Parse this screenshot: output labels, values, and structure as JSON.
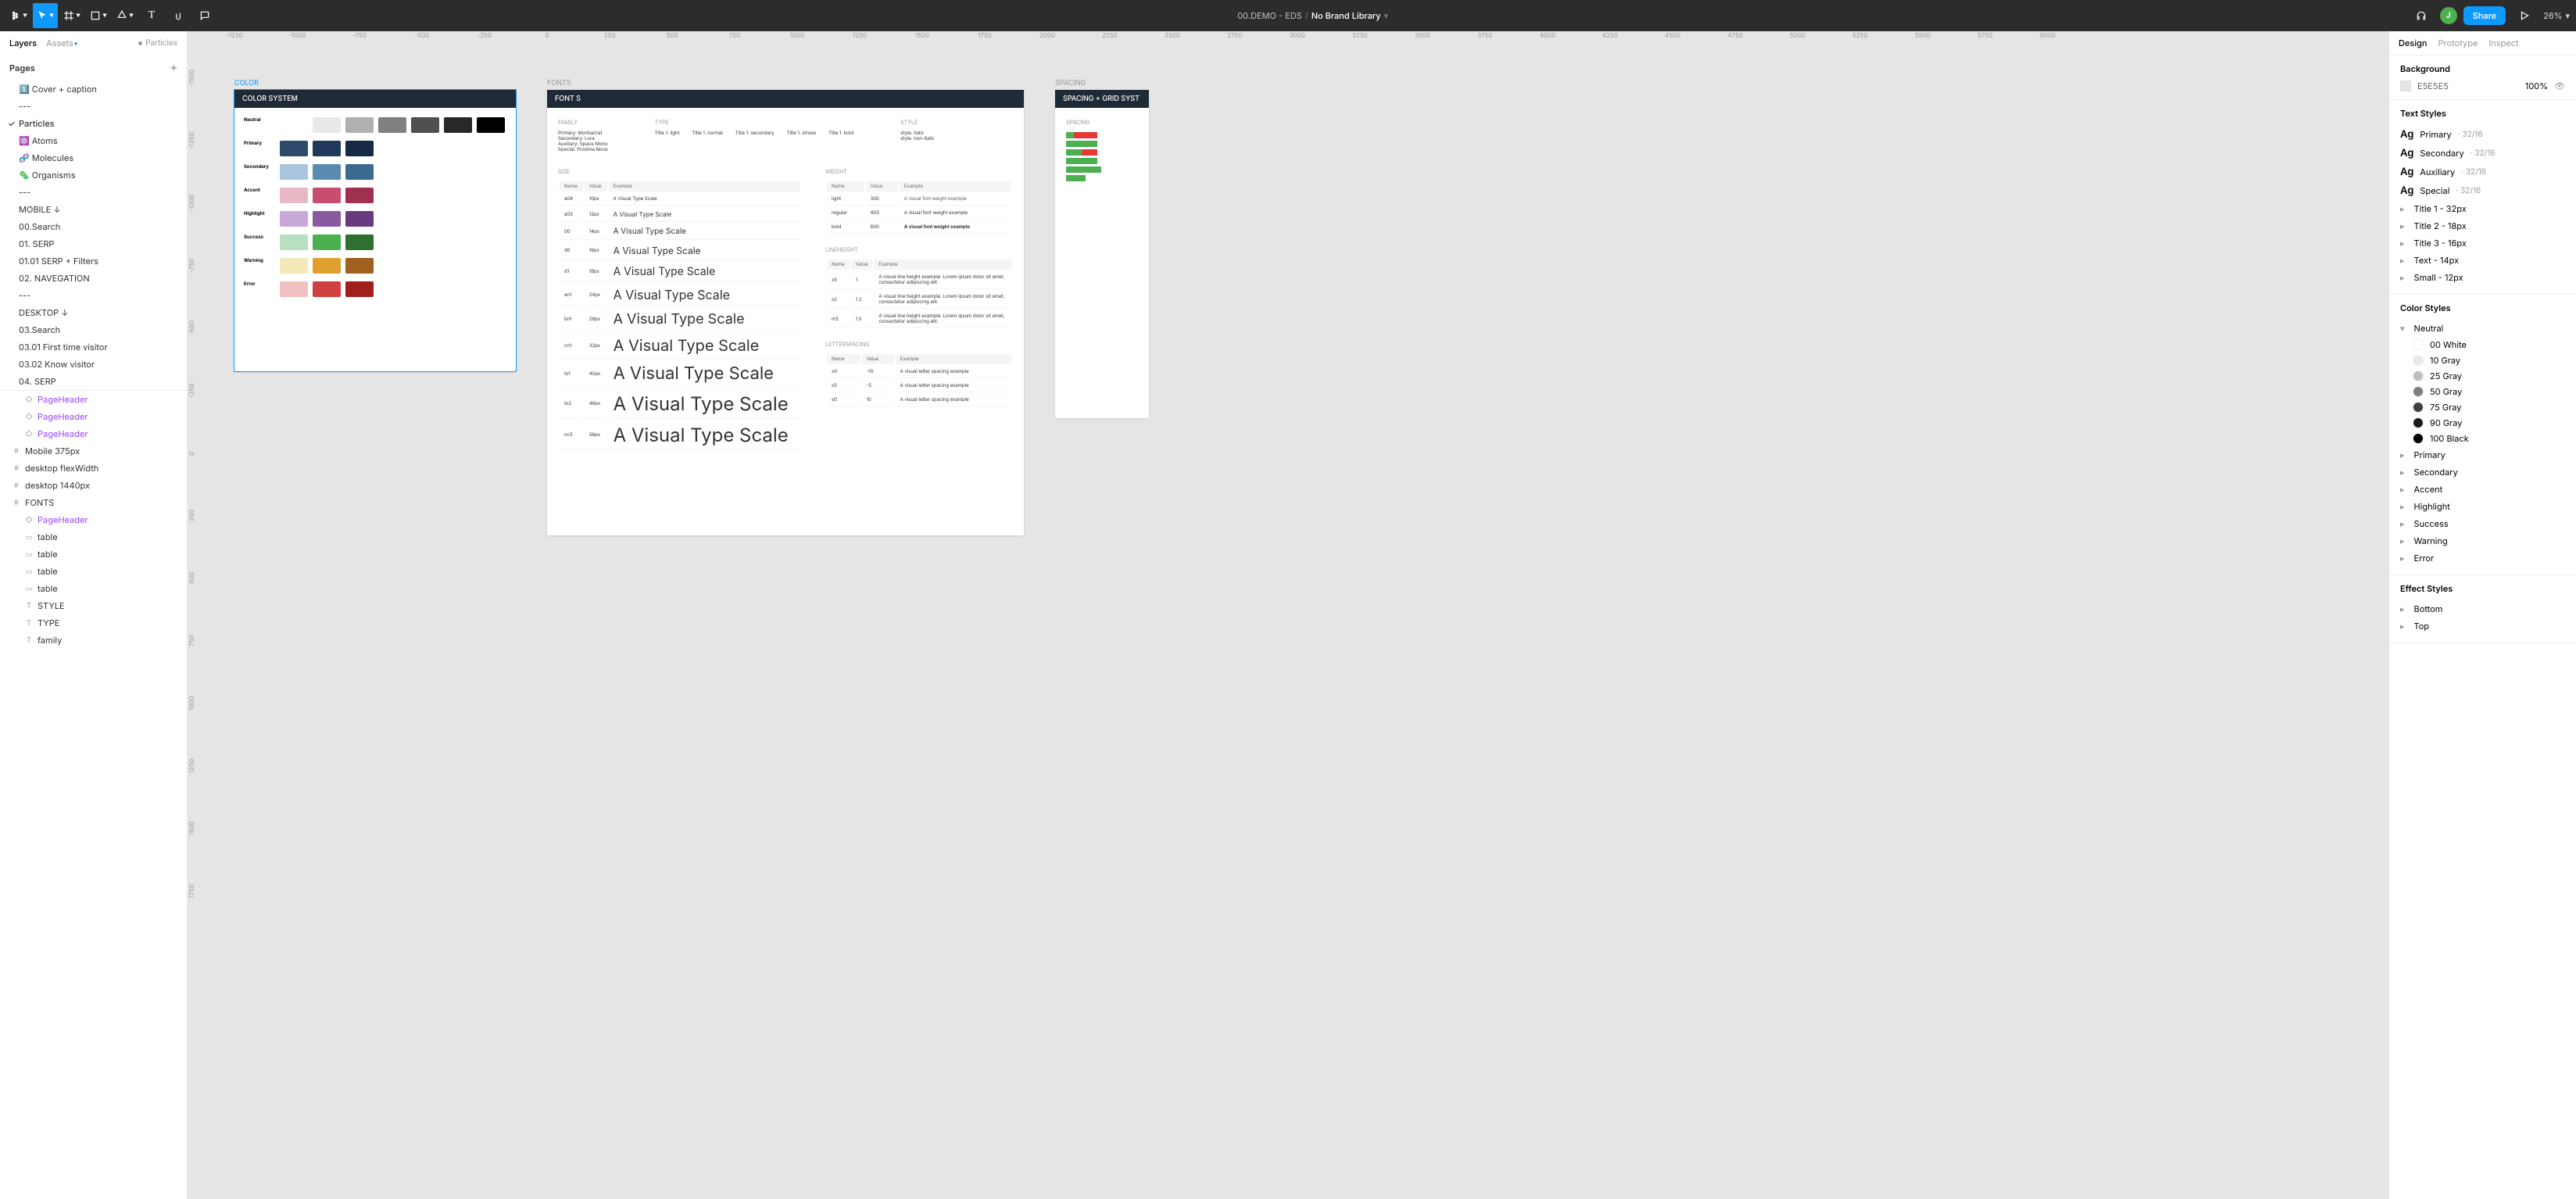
{
  "toolbar": {
    "file_path": "00.DEMO - EDS",
    "file_name": "No Brand Library",
    "share": "Share",
    "zoom": "26%",
    "avatar": "J"
  },
  "left": {
    "tabs": {
      "layers": "Layers",
      "assets": "Assets"
    },
    "location": "Particles",
    "pages_hdr": "Pages",
    "pages": [
      "1️⃣ Cover + caption",
      "---",
      "Particles",
      "⚛️ Atoms",
      "🧬 Molecules",
      "🦠 Organisms",
      "---",
      "MOBILE ↓",
      "00.Search",
      "01. SERP",
      "01.01 SERP + Filters",
      "02. NAVEGATION",
      "---",
      "DESKTOP ↓",
      "03.Search",
      "03.01 First time visitor",
      "03.02 Know visitor",
      "04. SERP"
    ],
    "selected_page": "Particles",
    "layers": [
      {
        "t": "PageHeader",
        "icon": "◇",
        "cls": "purple indent"
      },
      {
        "t": "PageHeader",
        "icon": "◇",
        "cls": "purple indent"
      },
      {
        "t": "PageHeader",
        "icon": "◇",
        "cls": "purple indent"
      },
      {
        "t": "Mobile 375px",
        "icon": "#"
      },
      {
        "t": "desktop flexWidth",
        "icon": "#"
      },
      {
        "t": "desktop 1440px",
        "icon": "#"
      },
      {
        "t": "FONTS",
        "icon": "#"
      },
      {
        "t": "PageHeader",
        "icon": "◇",
        "cls": "purple indent"
      },
      {
        "t": "table",
        "icon": "▭",
        "cls": "indent"
      },
      {
        "t": "table",
        "icon": "▭",
        "cls": "indent"
      },
      {
        "t": "table",
        "icon": "▭",
        "cls": "indent"
      },
      {
        "t": "table",
        "icon": "▭",
        "cls": "indent"
      },
      {
        "t": "STYLE",
        "icon": "T",
        "cls": "indent"
      },
      {
        "t": "TYPE",
        "icon": "T",
        "cls": "indent"
      },
      {
        "t": "family",
        "icon": "T",
        "cls": "indent"
      }
    ]
  },
  "ruler_h": [
    "-1250",
    "-1000",
    "-750",
    "-500",
    "-250",
    "0",
    "250",
    "500",
    "750",
    "1000",
    "1250",
    "1500",
    "1750",
    "2000",
    "2250",
    "2500",
    "2750",
    "3000",
    "3250",
    "3500",
    "3750",
    "4000",
    "4250",
    "4500",
    "4750",
    "5000",
    "5250",
    "5500",
    "5750",
    "6000"
  ],
  "ruler_v": [
    "-1500",
    "-1250",
    "-1000",
    "-750",
    "-500",
    "-250",
    "0",
    "250",
    "500",
    "750",
    "1000",
    "1250",
    "1500",
    "1750"
  ],
  "frames": {
    "color": {
      "label": "COLOR",
      "title": "COLOR SYSTEM",
      "rows": [
        {
          "name": "Neutral",
          "colors": [
            "#ffffff",
            "#e8e8e8",
            "#b0b0b0",
            "#808080",
            "#505050",
            "#282828",
            "#000000"
          ]
        },
        {
          "name": "Primary",
          "colors": [
            "#2e4a6b",
            "#1f3a5a",
            "#152b45"
          ]
        },
        {
          "name": "Secondary",
          "colors": [
            "#a8c5dd",
            "#5a8bb0",
            "#3a6a8f"
          ]
        },
        {
          "name": "Accent",
          "colors": [
            "#e8b8c5",
            "#c94d6f",
            "#a03050"
          ]
        },
        {
          "name": "Highlight",
          "colors": [
            "#c8a8d8",
            "#8a5aa0",
            "#6a3a80"
          ]
        },
        {
          "name": "Success",
          "colors": [
            "#b8e0c0",
            "#4caf50",
            "#2e7030"
          ]
        },
        {
          "name": "Warning",
          "colors": [
            "#f5e8b8",
            "#e0a030",
            "#a06020"
          ]
        },
        {
          "name": "Error",
          "colors": [
            "#f0c0c0",
            "#d04040",
            "#a02020"
          ]
        }
      ]
    },
    "fonts": {
      "label": "FONTS",
      "title": "FONT S",
      "family_hdr": "FAMILY",
      "type_hdr": "TYPE",
      "style_hdr": "STYLE",
      "families": [
        "Primary: Montserrat",
        "Secondary: Lora",
        "Auxiliary: Space Mono",
        "Special: Proxima Nova"
      ],
      "types": [
        "Title 1. light",
        "Title 1. normal",
        "Title 1. secondary",
        "Title 1. stroke",
        "Title 1. bold"
      ],
      "styles": [
        "style. italic",
        "style. non-italic"
      ],
      "size_hdr": "SIZE",
      "weight_hdr": "WEIGHT",
      "lineheight_hdr": "LINEHEIGHT",
      "letterspacing_hdr": "LETTERSPACING",
      "size_cols": [
        "Name",
        "Value",
        "Example"
      ],
      "sizes": [
        {
          "n": "a04",
          "v": "10px",
          "e": "A Visual Type Scale"
        },
        {
          "n": "a03",
          "v": "12px",
          "e": "A Visual Type Scale"
        },
        {
          "n": "00",
          "v": "14px",
          "e": "A Visual Type Scale"
        },
        {
          "n": "d0",
          "v": "16px",
          "e": "A Visual Type Scale"
        },
        {
          "n": "d1",
          "v": "18px",
          "e": "A Visual Type Scale"
        },
        {
          "n": "an1",
          "v": "24px",
          "e": "A Visual Type Scale"
        },
        {
          "n": "bn1",
          "v": "28px",
          "e": "A Visual Type Scale"
        },
        {
          "n": "cn1",
          "v": "32px",
          "e": "A Visual Type Scale"
        },
        {
          "n": "to1",
          "v": "40px",
          "e": "A Visual Type Scale"
        },
        {
          "n": "to2",
          "v": "48px",
          "e": "A Visual Type Scale"
        },
        {
          "n": "nc5",
          "v": "56px",
          "e": "A Visual Type Scale"
        }
      ],
      "weight_cols": [
        "Name",
        "Value",
        "Example"
      ],
      "weights": [
        {
          "n": "light",
          "v": "300",
          "e": "A visual font weight example"
        },
        {
          "n": "regular",
          "v": "400",
          "e": "A visual font weight example"
        },
        {
          "n": "bold",
          "v": "600",
          "e": "A visual font weight example"
        }
      ],
      "lh_cols": [
        "Name",
        "Value",
        "Example"
      ],
      "lhs": [
        {
          "n": "x5",
          "v": "1",
          "e": "A visual line height example. Lorem ipsum dolor sit amet, consectetur adipiscing elit."
        },
        {
          "n": "s2",
          "v": "1.2",
          "e": "A visual line height example. Lorem ipsum dolor sit amet, consectetur adipiscing elit."
        },
        {
          "n": "m5",
          "v": "1.5",
          "e": "A visual line height example. Lorem ipsum dolor sit amet, consectetur adipiscing elit."
        }
      ],
      "ls_cols": [
        "Name",
        "Value",
        "Example"
      ],
      "lss": [
        {
          "n": "x0",
          "v": "-10",
          "e": "A visual letter spacing example"
        },
        {
          "n": "s5",
          "v": "-5",
          "e": "A visual letter spacing example"
        },
        {
          "n": "s0",
          "v": "10",
          "e": "A visual letter spacing example"
        }
      ]
    },
    "spacing": {
      "label": "SPACING",
      "title": "SPACING + GRID SYST",
      "section": "SPACING"
    }
  },
  "right": {
    "tabs": {
      "design": "Design",
      "prototype": "Prototype",
      "inspect": "Inspect"
    },
    "bg_hdr": "Background",
    "bg_hex": "E5E5E5",
    "bg_pct": "100%",
    "ts_hdr": "Text Styles",
    "text_styles": [
      {
        "n": "Primary",
        "m": "32/16"
      },
      {
        "n": "Secondary",
        "m": "32/16"
      },
      {
        "n": "Auxiliary",
        "m": "32/16"
      },
      {
        "n": "Special",
        "m": "32/16"
      }
    ],
    "title_styles": [
      "Title 1 - 32px",
      "Title 2 - 18px",
      "Title 3 - 16px",
      "Text - 14px",
      "Small - 12px"
    ],
    "cs_hdr": "Color Styles",
    "neutral_hdr": "Neutral",
    "neutrals": [
      {
        "n": "00 White",
        "c": "#ffffff"
      },
      {
        "n": "10 Gray",
        "c": "#e8e8e8"
      },
      {
        "n": "25 Gray",
        "c": "#bfbfbf"
      },
      {
        "n": "50 Gray",
        "c": "#808080"
      },
      {
        "n": "75 Gray",
        "c": "#404040"
      },
      {
        "n": "90 Gray",
        "c": "#1a1a1a"
      },
      {
        "n": "100 Black",
        "c": "#000000"
      }
    ],
    "color_groups": [
      "Primary",
      "Secondary",
      "Accent",
      "Highlight",
      "Success",
      "Warning",
      "Error"
    ],
    "es_hdr": "Effect Styles",
    "effects": [
      "Bottom",
      "Top"
    ]
  }
}
